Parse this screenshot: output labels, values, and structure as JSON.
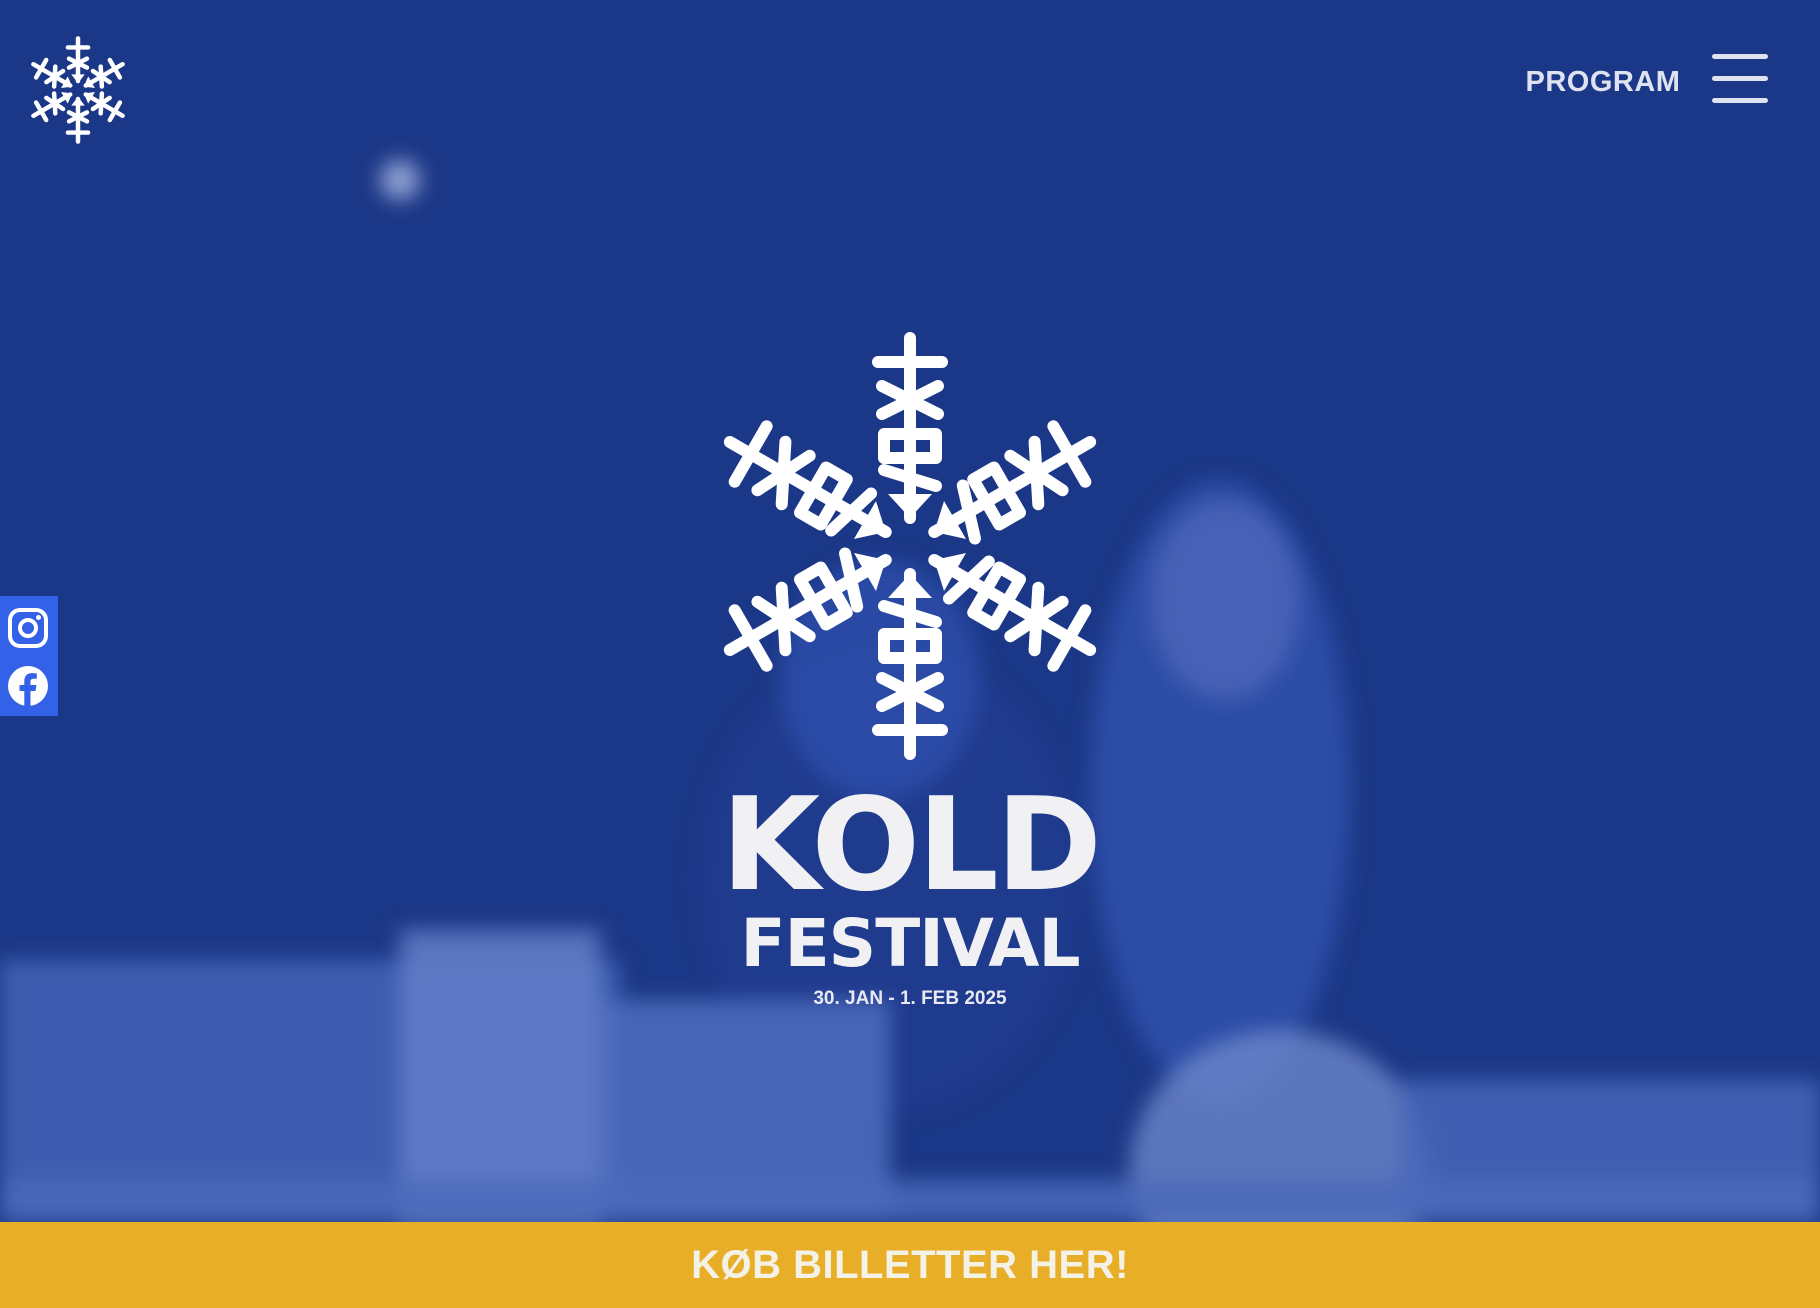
{
  "brand": {
    "name": "KOLD",
    "subtitle": "FESTIVAL",
    "dates": "30. JAN - 1. FEB 2025"
  },
  "nav": {
    "program_label": "PROGRAM",
    "menu_icon": "hamburger-menu-icon"
  },
  "social": {
    "items": [
      {
        "icon": "instagram-icon"
      },
      {
        "icon": "facebook-icon"
      }
    ]
  },
  "cta": {
    "label": "KØB BILLETTER HER!"
  },
  "colors": {
    "hero_overlay": "#1b3784",
    "accent": "#e9ae27",
    "social_bg": "#3361e8",
    "text": "#f1f1f4"
  }
}
